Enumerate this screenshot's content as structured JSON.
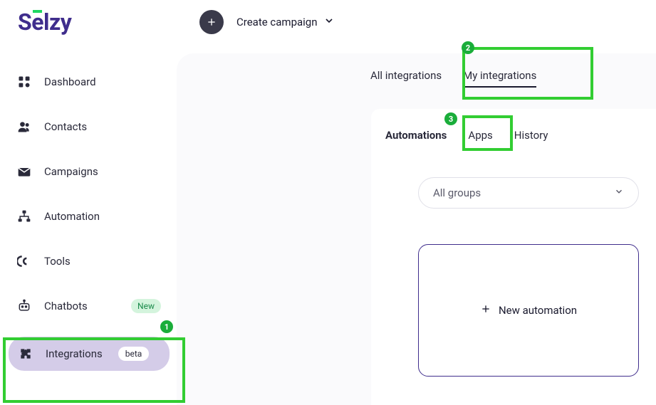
{
  "brand": {
    "name": "Selzy"
  },
  "header": {
    "create_label": "Create campaign"
  },
  "sidebar": {
    "items": [
      {
        "label": "Dashboard"
      },
      {
        "label": "Contacts"
      },
      {
        "label": "Campaigns"
      },
      {
        "label": "Automation"
      },
      {
        "label": "Tools"
      },
      {
        "label": "Chatbots",
        "badge": "New"
      },
      {
        "label": "Integrations",
        "badge": "beta"
      }
    ]
  },
  "tabs": {
    "top": [
      {
        "label": "All integrations"
      },
      {
        "label": "My integrations"
      }
    ],
    "sub": [
      {
        "label": "Automations"
      },
      {
        "label": "Apps"
      },
      {
        "label": "History"
      }
    ]
  },
  "filter": {
    "groups_label": "All groups"
  },
  "actions": {
    "new_automation": "New automation"
  },
  "annotations": {
    "n1": "1",
    "n2": "2",
    "n3": "3"
  }
}
